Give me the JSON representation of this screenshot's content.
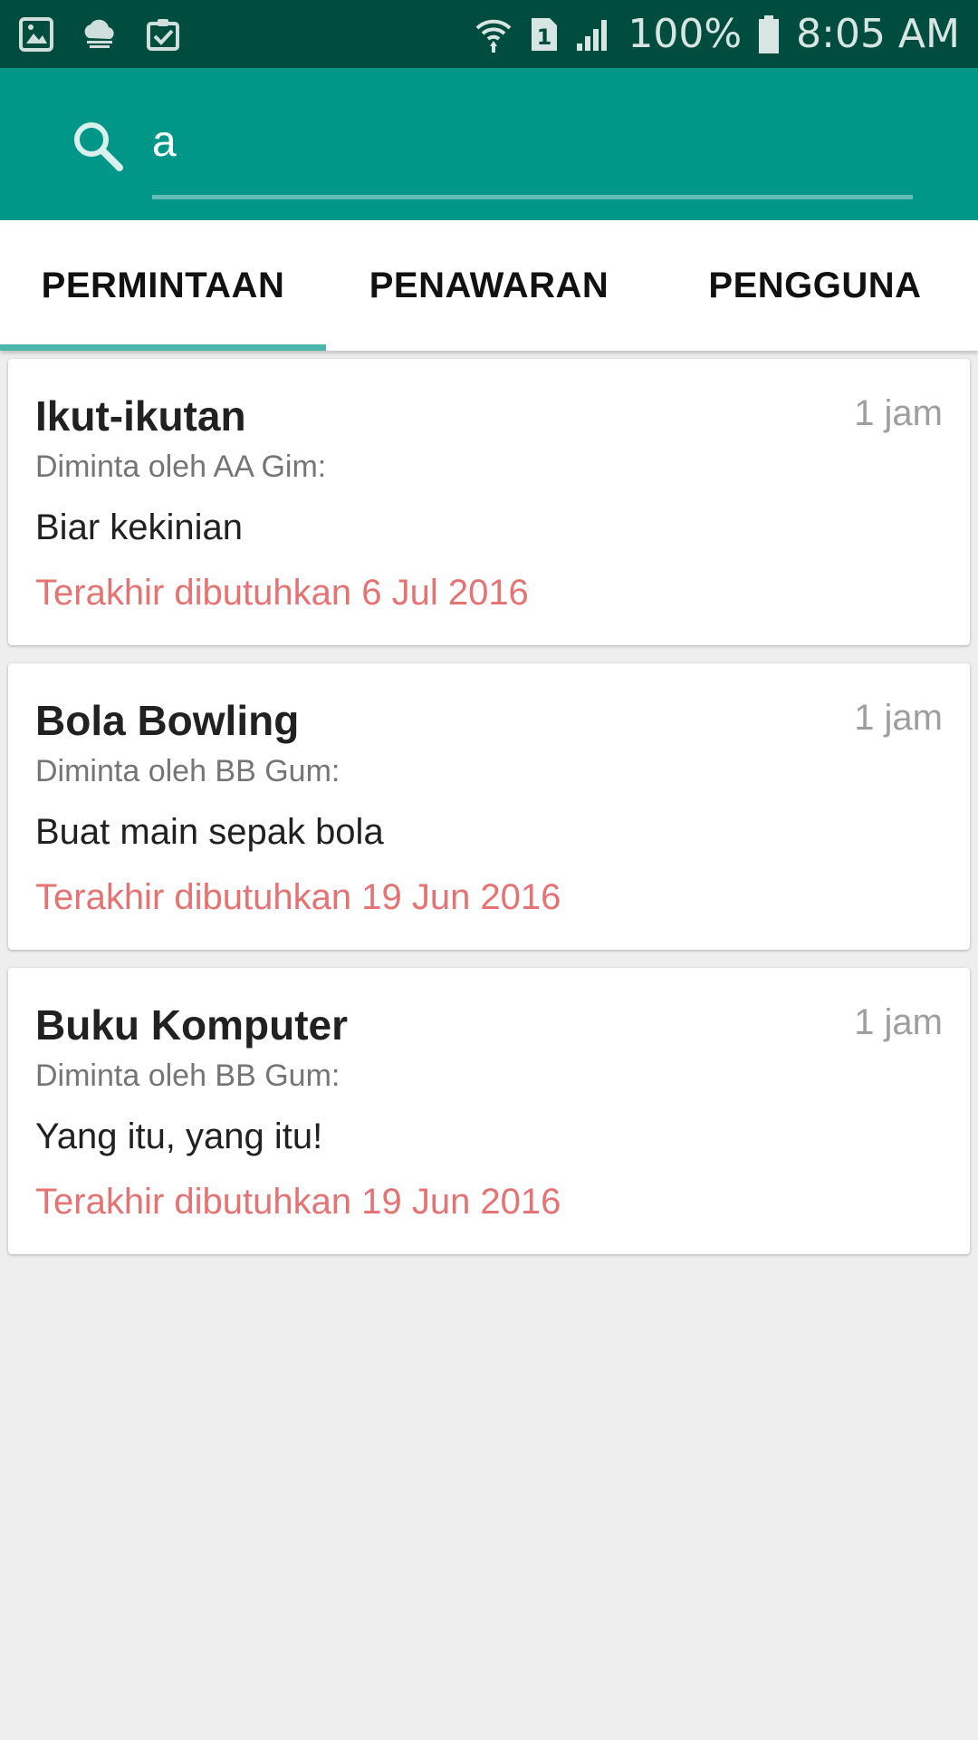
{
  "status_bar": {
    "battery": "100%",
    "time": "8:05 AM",
    "sim_slot": "1",
    "left_icons": [
      "gallery-icon",
      "cloud-icon",
      "clipboard-check-icon"
    ],
    "right_icons": [
      "wifi-icon",
      "sim-icon",
      "signal-icon",
      "battery-icon"
    ]
  },
  "search": {
    "value": "a",
    "icon": "search-icon"
  },
  "tabs": [
    {
      "label": "PERMINTAAN",
      "selected": true
    },
    {
      "label": "PENAWARAN",
      "selected": false
    },
    {
      "label": "PENGGUNA",
      "selected": false
    }
  ],
  "cards": [
    {
      "title": "Ikut-ikutan",
      "time": "1 jam",
      "requester": "Diminta oleh AA Gim:",
      "description": "Biar kekinian",
      "deadline": "Terakhir dibutuhkan 6 Jul 2016"
    },
    {
      "title": "Bola Bowling",
      "time": "1 jam",
      "requester": "Diminta oleh BB Gum:",
      "description": "Buat main sepak bola",
      "deadline": "Terakhir dibutuhkan 19 Jun 2016"
    },
    {
      "title": "Buku Komputer",
      "time": "1 jam",
      "requester": "Diminta oleh BB Gum:",
      "description": "Yang itu, yang itu!",
      "deadline": "Terakhir dibutuhkan 19 Jun 2016"
    }
  ],
  "colors": {
    "status_bar": "#004d40",
    "header": "#009688",
    "tab_indicator": "#4db6ac",
    "deadline": "#e57373",
    "background": "#eeeeee"
  }
}
